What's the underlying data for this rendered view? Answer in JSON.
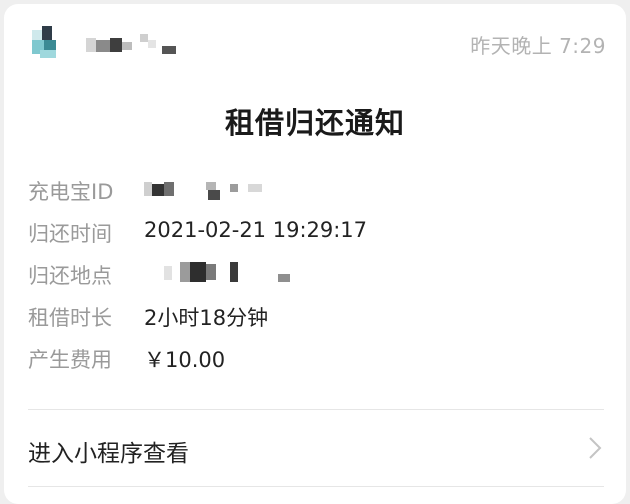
{
  "header": {
    "timestamp": "昨天晚上 7:29"
  },
  "notice": {
    "title": "租借归还通知",
    "fields": [
      {
        "label": "充电宝ID",
        "value": ""
      },
      {
        "label": "归还时间",
        "value": "2021-02-21 19:29:17"
      },
      {
        "label": "归还地点",
        "value": ""
      },
      {
        "label": "租借时长",
        "value": "2小时18分钟"
      },
      {
        "label": "产生费用",
        "value": "￥10.00"
      }
    ]
  },
  "entry": {
    "label": "进入小程序查看",
    "icon": "chevron-right-icon"
  },
  "colors": {
    "avatar_accent": "#7fc8cf",
    "timestamp": "#b3b3b3",
    "label": "#9a9a9a"
  }
}
